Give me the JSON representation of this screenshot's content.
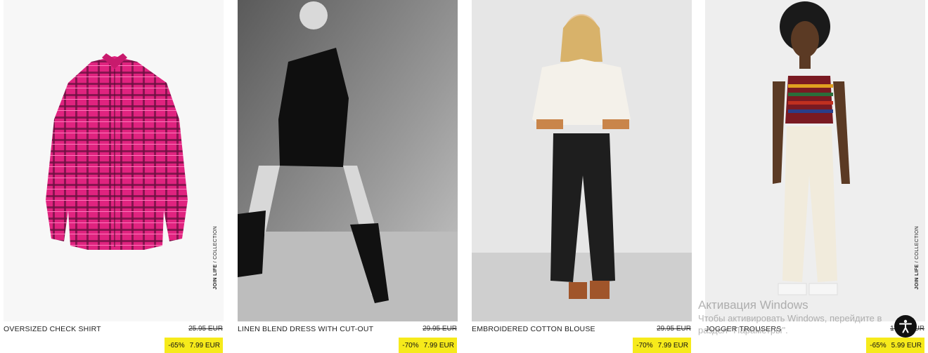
{
  "products": [
    {
      "name": "OVERSIZED CHECK SHIRT",
      "old_price": "25.95 EUR",
      "discount": "-65%",
      "price": "7.99 EUR",
      "collection_tag": {
        "brand": "JOIN LIFE",
        "suffix": " / COLLECTION"
      }
    },
    {
      "name": "LINEN BLEND DRESS WITH CUT-OUT",
      "old_price": "29.95 EUR",
      "discount": "-70%",
      "price": "7.99 EUR"
    },
    {
      "name": "EMBROIDERED COTTON BLOUSE",
      "old_price": "29.95 EUR",
      "discount": "-70%",
      "price": "7.99 EUR"
    },
    {
      "name": "JOGGER TROUSERS",
      "old_price": "17.95 EUR",
      "discount": "-65%",
      "price": "5.99 EUR",
      "collection_tag": {
        "brand": "JOIN LIFE",
        "suffix": " / COLLECTION"
      }
    }
  ],
  "windows_watermark": {
    "title": "Активация Windows",
    "line1": "Чтобы активировать Windows, перейдите в",
    "line2": "раздел \"Параметры\"."
  },
  "accessibility_button": {
    "icon": "accessibility-person-icon"
  },
  "colors": {
    "sale_badge": "#f6ea1b",
    "text": "#222222"
  }
}
